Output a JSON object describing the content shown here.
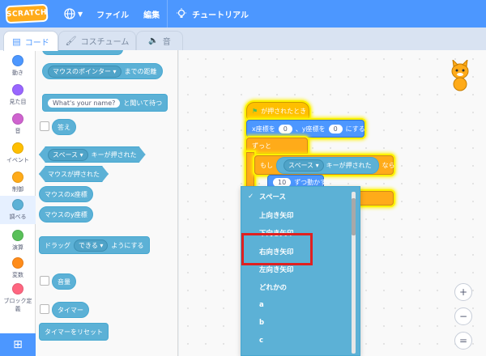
{
  "menubar": {
    "logo": "SCRATCH",
    "file": "ファイル",
    "edit": "編集",
    "tutorial": "チュートリアル"
  },
  "tabs": [
    {
      "label": "コード",
      "icon": "code-icon"
    },
    {
      "label": "コスチューム",
      "icon": "brush-icon"
    },
    {
      "label": "音",
      "icon": "speaker-icon"
    }
  ],
  "categories": [
    {
      "label": "動き",
      "color": "#4c97ff"
    },
    {
      "label": "見た目",
      "color": "#9966ff"
    },
    {
      "label": "音",
      "color": "#cf63cf"
    },
    {
      "label": "イベント",
      "color": "#ffbf00"
    },
    {
      "label": "制御",
      "color": "#ffab19"
    },
    {
      "label": "調べる",
      "color": "#5cb1d6"
    },
    {
      "label": "演算",
      "color": "#59c059"
    },
    {
      "label": "変数",
      "color": "#ff8c1a"
    },
    {
      "label": "ブロック定義",
      "color": "#ff6680"
    }
  ],
  "palette": {
    "distance_dropdown": "マウスのポインター",
    "distance_suffix": "までの距離",
    "ask_default": "What's your name?",
    "ask_suffix": "と聞いて待つ",
    "answer": "答え",
    "key_dropdown": "スペース",
    "key_suffix": "キーが押された",
    "mouse_down": "マウスが押された",
    "mouse_x": "マウスのx座標",
    "mouse_y": "マウスのy座標",
    "drag_prefix": "ドラッグ",
    "drag_dropdown": "できる",
    "drag_suffix": "ようにする",
    "loudness": "音量",
    "timer": "タイマー",
    "reset_timer": "タイマーをリセット"
  },
  "script": {
    "hat": "が押されたとき",
    "goto_x_label": "x座標を",
    "goto_x": "0",
    "goto_sep": "、y座標を",
    "goto_y": "0",
    "goto_suffix": "にする",
    "forever": "ずっと",
    "if_label": "もし",
    "if_key": "スペース",
    "if_key_suffix": "キーが押された",
    "if_then": "なら",
    "inner_value": "10",
    "inner_label": "ずつ動かす"
  },
  "dropdown": {
    "selected": "スペース",
    "items": [
      "スペース",
      "上向き矢印",
      "下向き矢印",
      "右向き矢印",
      "左向き矢印",
      "どれかの",
      "a",
      "b",
      "c"
    ],
    "highlighted": "右向き矢印"
  },
  "zoom": {
    "in": "+",
    "out": "−",
    "reset": "="
  }
}
